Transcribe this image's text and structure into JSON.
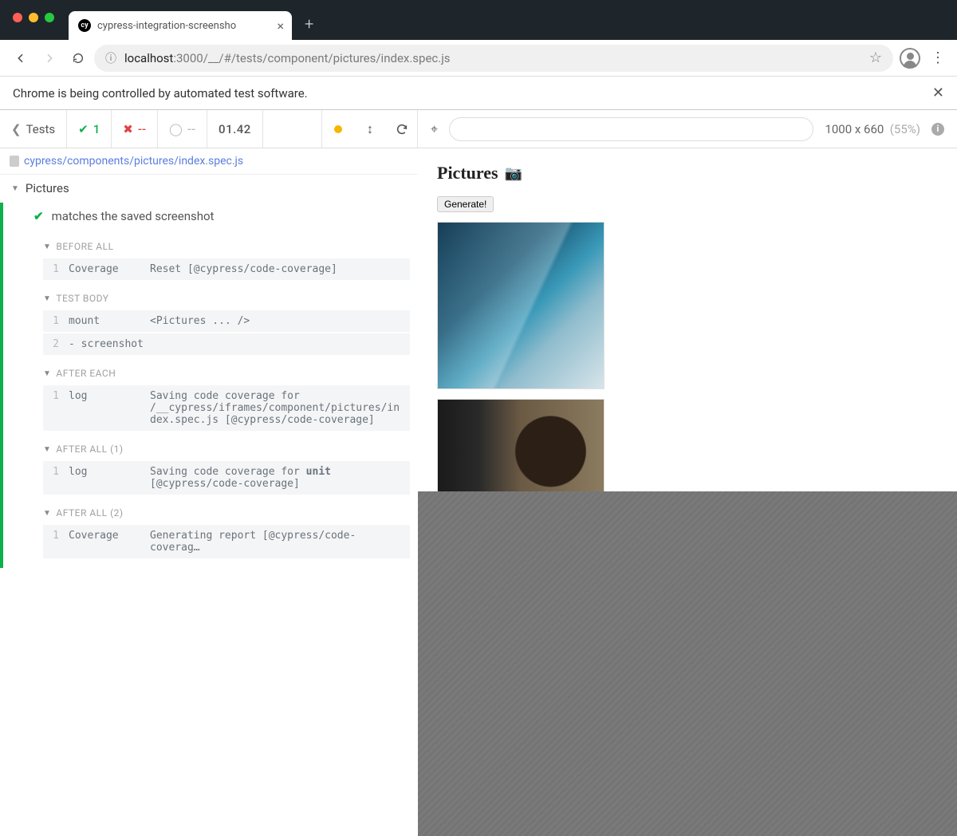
{
  "browser": {
    "tab_title": "cypress-integration-screensho",
    "url_host": "localhost",
    "url_port": ":3000",
    "url_path": "/__/#/tests/component/pictures/index.spec.js"
  },
  "info_bar": {
    "text": "Chrome is being controlled by automated test software."
  },
  "runner": {
    "tests_label": "Tests",
    "passed": "1",
    "failed": "--",
    "pending": "--",
    "duration": "01.42",
    "viewport": "1000 x 660",
    "viewport_pct": "(55%)"
  },
  "spec": {
    "path": "cypress/components/pictures/index.spec.js"
  },
  "describe": {
    "title": "Pictures"
  },
  "test": {
    "title": "matches the saved screenshot"
  },
  "sections": {
    "before_all": "BEFORE ALL",
    "test_body": "TEST BODY",
    "after_each": "AFTER EACH",
    "after_all_1": "AFTER ALL (1)",
    "after_all_2": "AFTER ALL (2)"
  },
  "commands": {
    "before_all_1": {
      "num": "1",
      "name": "Coverage",
      "args": "Reset [@cypress/code-coverage]"
    },
    "body_1": {
      "num": "1",
      "name": "mount",
      "args": "<Pictures ... />"
    },
    "body_2": {
      "num": "2",
      "name": "- screenshot",
      "args": ""
    },
    "after_each_1": {
      "num": "1",
      "name": "log",
      "args": "Saving code coverage for /__cypress/iframes/component/pictures/index.spec.js [@cypress/code-coverage]"
    },
    "after_all_1_1": {
      "num": "1",
      "name": "log",
      "args_a": "Saving code coverage for ",
      "args_b": "unit",
      "args_c": " [@cypress/code-coverage]"
    },
    "after_all_2_1": {
      "num": "1",
      "name": "Coverage",
      "args": "Generating report [@cypress/code-coverag…"
    }
  },
  "aut": {
    "title": "Pictures",
    "generate_btn": "Generate!"
  }
}
